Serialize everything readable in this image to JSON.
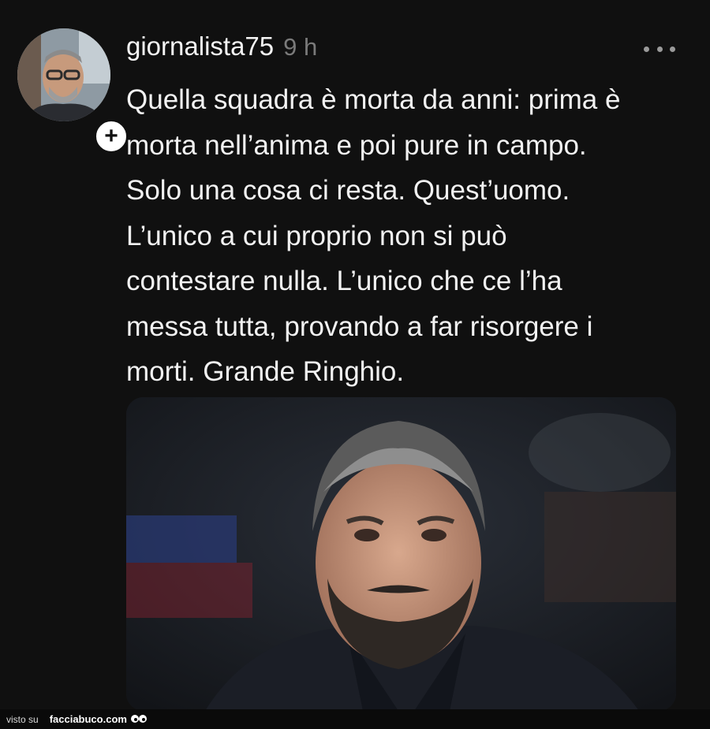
{
  "post": {
    "username": "giornalista75",
    "timestamp": "9 h",
    "follow_symbol": "+",
    "text": "Quella squadra è morta da anni: prima è\nmorta nell’anima e poi pure in campo.\nSolo una cosa ci resta. Quest’uomo.\nL’unico a cui proprio non si può\ncontestare nulla. L’unico che ce l’ha\nmessa tutta, provando a far risorgere i\nmorti. Grande Ringhio.",
    "icons": {
      "avatar": "avatar-photo",
      "follow": "plus-icon",
      "menu": "more-options-icon",
      "attachment": "photo-man-grey-hair-beard"
    }
  },
  "watermark": {
    "prefix": "visto su",
    "brand": "facciabuco.com",
    "icon": "eyes-icon"
  },
  "colors": {
    "background": "#101010",
    "text": "#f2f2f2",
    "muted": "#7a7a7a"
  }
}
